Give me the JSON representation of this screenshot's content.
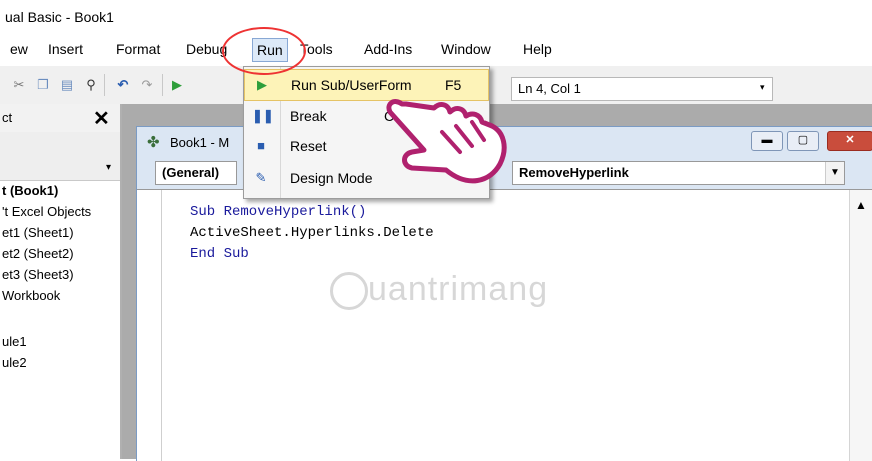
{
  "title": "ual Basic - Book1",
  "menubar": {
    "items": [
      "ew",
      "Insert",
      "Format",
      "Debug",
      "Run",
      "Tools",
      "Add-Ins",
      "Window",
      "Help"
    ]
  },
  "toolbar": {
    "position": "Ln 4, Col 1"
  },
  "run_menu": {
    "items": [
      {
        "label": "Run Sub/UserForm",
        "shortcut": "F5",
        "icon": "play-icon"
      },
      {
        "label": "Break",
        "shortcut": "Ctrl+Break",
        "icon": "pause-icon"
      },
      {
        "label": "Reset",
        "shortcut": "",
        "icon": "stop-icon"
      },
      {
        "label": "Design Mode",
        "shortcut": "",
        "icon": "design-mode-icon"
      }
    ]
  },
  "project_panel": {
    "title": "ct",
    "close": "✕",
    "tree": [
      "t (Book1)",
      "'t Excel Objects",
      "et1 (Sheet1)",
      "et2 (Sheet2)",
      "et3 (Sheet3)",
      "Workbook",
      "ule1",
      "ule2"
    ]
  },
  "code_window": {
    "title": "Book1 - M",
    "object_combo": "(General)",
    "proc_combo": "RemoveHyperlink",
    "code_lines": [
      "Sub RemoveHyperlink()",
      "ActiveSheet.Hyperlinks.Delete",
      "End Sub"
    ]
  },
  "watermark": "uantrimang",
  "colors": {
    "highlight": "#fdf3b8",
    "annotation": "#ee3333",
    "keyword": "#1a1a9c"
  }
}
